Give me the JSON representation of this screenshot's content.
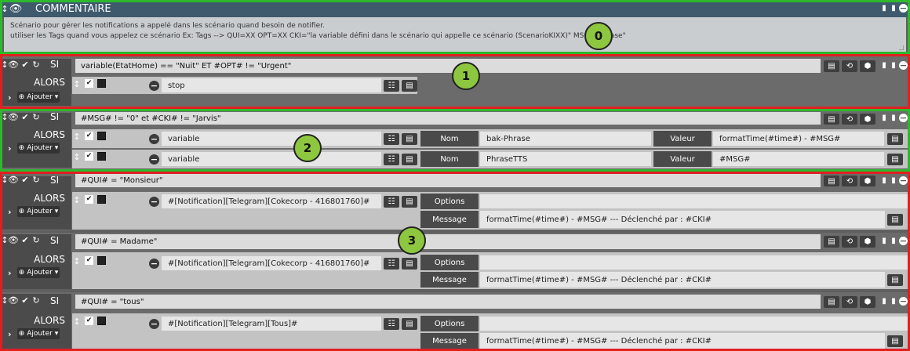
{
  "comment": {
    "title": "COMMENTAIRE",
    "line1": "Scénario pour gérer les notifications a appelé dans les scénario quand besoin de notifier.",
    "line2": "utiliser les Tags quand vous appelez ce scénario Ex: Tags --> QUI=XX OPT=XX CKI=\"la variable défini dans le scénario qui appelle ce scénario (ScenarioKIXX)\" MSG=\"Phrase\"",
    "badge": "0"
  },
  "labels": {
    "si": "SI",
    "alors": "ALORS",
    "ajouter": "Ajouter",
    "nom": "Nom",
    "valeur": "Valeur",
    "options": "Options",
    "message": "Message"
  },
  "blocks": [
    {
      "condition": "variable(EtatHome) == \"Nuit\" ET #OPT# != \"Urgent\"",
      "badge": "1",
      "actions": [
        {
          "name": "stop"
        }
      ]
    },
    {
      "condition": "#MSG# != \"0\" et #CKI# != \"Jarvis\"",
      "badge": "2",
      "actions": [
        {
          "name": "variable",
          "nom": "bak-Phrase",
          "valeur": "formatTime(#time#) - #MSG#"
        },
        {
          "name": "variable",
          "nom": "PhraseTTS",
          "valeur": "#MSG#"
        }
      ]
    },
    {
      "condition": "#QUI# = \"Monsieur\"",
      "actions": [
        {
          "name": "#[Notification][Telegram][Cokecorp - 416801760]#",
          "message": "formatTime(#time#) - #MSG# --- Déclenché par : #CKI#"
        }
      ]
    },
    {
      "condition": "#QUI# = Madame\"",
      "badge": "3",
      "actions": [
        {
          "name": "#[Notification][Telegram][Cokecorp - 416801760]#",
          "message": "formatTime(#time#) - #MSG# --- Déclenché par : #CKI#"
        }
      ]
    },
    {
      "condition": "#QUI# = \"tous\"",
      "actions": [
        {
          "name": "#[Notification][Telegram][Tous]#",
          "message": "formatTime(#time#) - #MSG# --- Déclenché par : #CKI#"
        }
      ]
    }
  ],
  "colors": {
    "frame_green": "#2eb82e",
    "frame_red": "#e02020",
    "badge_green": "#8dc63f",
    "comment_header": "#3f5a6c",
    "comment_body": "#c9cdd0"
  }
}
